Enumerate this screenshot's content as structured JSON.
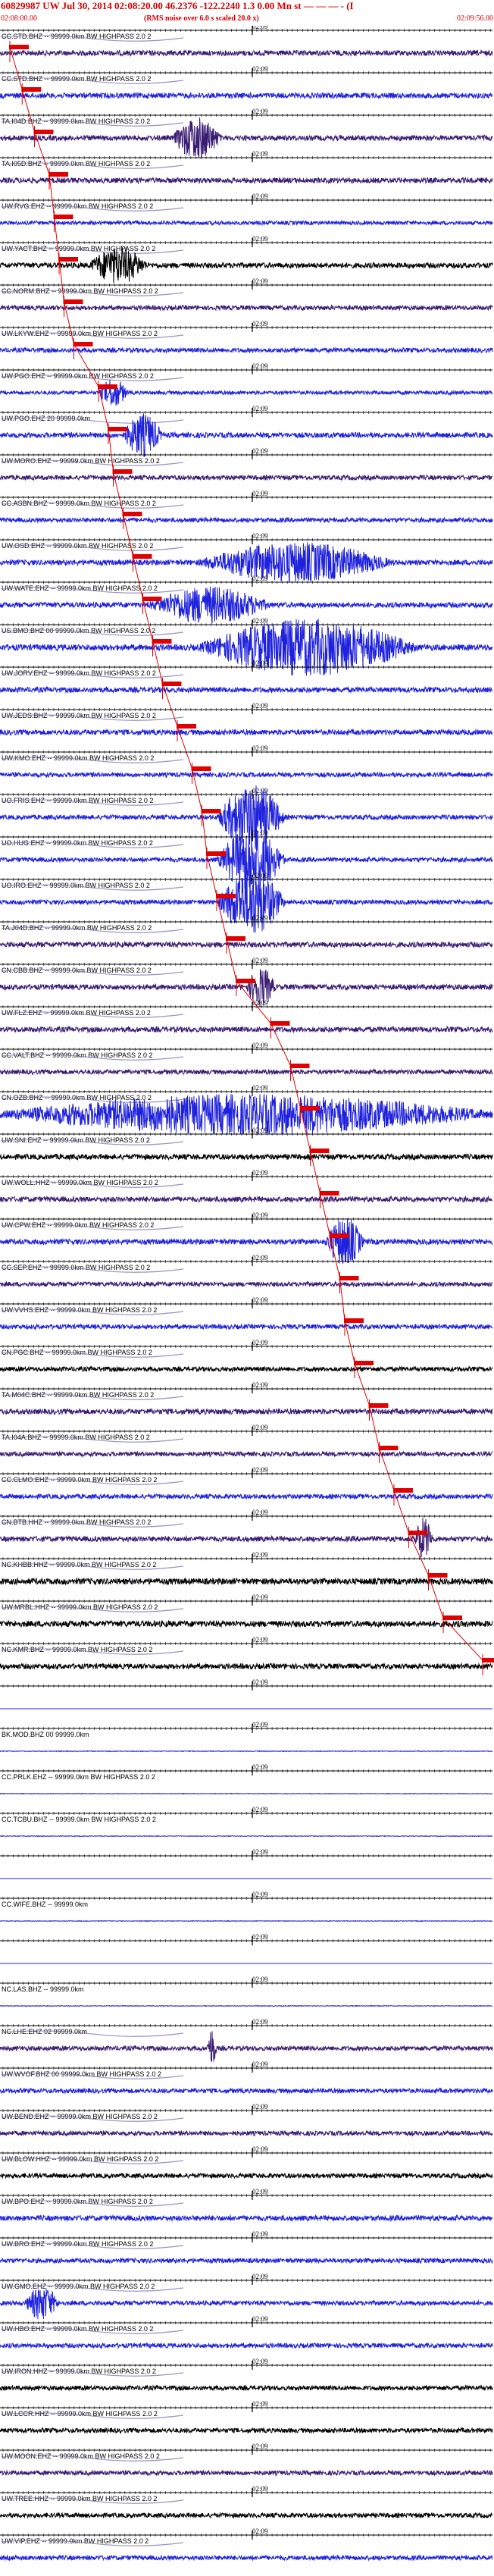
{
  "header": {
    "title": "60829987 UW Jul 30, 2014 02:08:20.00    46.2376 -122.2240  1.3 0.00 Mn st — — — - (I",
    "subtitle": "(RMS noise over 6.0 s scaled 20.0 x)",
    "time_left": "02:08:00.00",
    "time_right": "02:09:56.00"
  },
  "minute_mark": "02:09",
  "colors": {
    "header": "#d40000",
    "pick": "#e00000",
    "blue": "#1f22dd",
    "purple": "#3a1d73",
    "black": "#000000",
    "scrawl": "#7a6fb0"
  },
  "chart_data": {
    "type": "seismogram",
    "title": "60829987 UW Jul 30, 2014 02:08:20.00    46.2376 -122.2240  1.3 0.00 Mn st — — — - (I",
    "time_range": [
      "02:08:00.00",
      "02:09:56.00"
    ],
    "traces": [
      {
        "label": "CC.STD.BHZ -- 99999.0km BW HIGHPASS 2.0 2",
        "color": "purple",
        "amp": 0.35,
        "events": [],
        "pick": 0.02
      },
      {
        "label": "CC.STD.BHZ -- 99999.0km BW HIGHPASS 2.0 2",
        "color": "blue",
        "amp": 0.35,
        "events": [],
        "pick": 0.045
      },
      {
        "label": "TA.I04D.BHZ -- 99999.0km BW HIGHPASS 2.0 2",
        "color": "purple",
        "amp": 0.35,
        "events": [
          [
            0.35,
            0.45,
            1.4
          ]
        ],
        "pick": 0.07
      },
      {
        "label": "TA.I05D.BHZ -- 99999.0km BW HIGHPASS 2.0 2",
        "color": "purple",
        "amp": 0.35,
        "events": [],
        "pick": 0.1
      },
      {
        "label": "UW.RVG.EHZ -- 99999.0km BW HIGHPASS 2.0 2",
        "color": "blue",
        "amp": 0.25,
        "events": [],
        "pick": 0.11
      },
      {
        "label": "UW.YACT.BHZ -- 99999.0km BW HIGHPASS 2.0 2",
        "color": "black",
        "amp": 0.35,
        "events": [
          [
            0.18,
            0.3,
            1.2
          ]
        ],
        "pick": 0.12
      },
      {
        "label": "CC.NORM.BHZ -- 99999.0km BW HIGHPASS 2.0 2",
        "color": "purple",
        "amp": 0.3,
        "events": [],
        "pick": 0.13
      },
      {
        "label": "UW.LKYW.EHZ -- 99999.0km BW HIGHPASS 2.0 2",
        "color": "blue",
        "amp": 0.3,
        "events": [],
        "pick": 0.15
      },
      {
        "label": "UW.PGO.EHZ -- 99999.0km BW HIGHPASS 2.0 2",
        "color": "blue",
        "amp": 0.25,
        "events": [
          [
            0.2,
            0.26,
            1.3
          ]
        ],
        "pick": 0.2
      },
      {
        "label": "UW.PGO.EHZ 20 99999.0km",
        "color": "blue",
        "amp": 0.35,
        "events": [
          [
            0.25,
            0.33,
            1.4
          ]
        ],
        "pick": 0.22
      },
      {
        "label": "UW.MORO.EHZ -- 99999.0km BW HIGHPASS 2.0 2",
        "color": "purple",
        "amp": 0.3,
        "events": [],
        "pick": 0.23
      },
      {
        "label": "CC.ASBN.BHZ -- 99999.0km BW HIGHPASS 2.0 2",
        "color": "blue",
        "amp": 0.3,
        "events": [],
        "pick": 0.25
      },
      {
        "label": "UW.OSD.EHZ -- 99999.0km BW HIGHPASS 2.0 2",
        "color": "blue",
        "amp": 0.35,
        "events": [
          [
            0.4,
            0.8,
            1.3
          ]
        ],
        "pick": 0.27
      },
      {
        "label": "UW.WATE.EHZ -- 99999.0km BW HIGHPASS 2.0 2",
        "color": "blue",
        "amp": 0.35,
        "events": [
          [
            0.3,
            0.55,
            1.2
          ]
        ],
        "pick": 0.29
      },
      {
        "label": "US.BMO.BHZ 00 99999.0km BW HIGHPASS 2.0 2",
        "color": "blue",
        "amp": 0.4,
        "events": [
          [
            0.4,
            0.85,
            1.6
          ]
        ],
        "pick": 0.31
      },
      {
        "label": "UW.JORV.EHZ -- 99999.0km BW HIGHPASS 2.0 2",
        "color": "blue",
        "amp": 0.35,
        "events": [],
        "pick": 0.33
      },
      {
        "label": "UW.JEDS.BHZ -- 99999.0km BW HIGHPASS 2.0 2",
        "color": "blue",
        "amp": 0.35,
        "events": [],
        "pick": 0.36
      },
      {
        "label": "UW.KMO.EHZ -- 99999.0km BW HIGHPASS 2.0 2",
        "color": "blue",
        "amp": 0.3,
        "events": [],
        "pick": 0.39
      },
      {
        "label": "UO.FRIS.EHZ -- 99999.0km BW HIGHPASS 2.0 2",
        "color": "blue",
        "amp": 0.3,
        "events": [
          [
            0.44,
            0.58,
            2.5
          ]
        ],
        "pick": 0.41
      },
      {
        "label": "UO.HUG.EHZ -- 99999.0km BW HIGHPASS 2.0 2",
        "color": "blue",
        "amp": 0.3,
        "events": [
          [
            0.44,
            0.58,
            2.5
          ]
        ],
        "pick": 0.42
      },
      {
        "label": "UO.IRO.EHZ -- 99999.0km BW HIGHPASS 2.0 2",
        "color": "blue",
        "amp": 0.3,
        "events": [
          [
            0.44,
            0.58,
            2.5
          ]
        ],
        "pick": 0.44
      },
      {
        "label": "TA.J04D.BHZ -- 99999.0km BW HIGHPASS 2.0 2",
        "color": "purple",
        "amp": 0.35,
        "events": [],
        "pick": 0.46
      },
      {
        "label": "CN.CBB.BHZ -- 99999.0km BW HIGHPASS 2.0 2",
        "color": "purple",
        "amp": 0.35,
        "events": [
          [
            0.5,
            0.56,
            1.3
          ]
        ],
        "pick": 0.48
      },
      {
        "label": "UW.FLZ.EHZ -- 99999.0km BW HIGHPASS 2.0 2",
        "color": "purple",
        "amp": 0.35,
        "events": [],
        "pick": 0.55
      },
      {
        "label": "CC.VALT.BHZ -- 99999.0km BW HIGHPASS 2.0 2",
        "color": "purple",
        "amp": 0.3,
        "events": [],
        "pick": 0.59
      },
      {
        "label": "CN.OZB.BHZ -- 99999.0km BW HIGHPASS 2.0 2",
        "color": "blue",
        "amp": 0.45,
        "events": [
          [
            0.0,
            1.0,
            1.0
          ]
        ],
        "pick": 0.61
      },
      {
        "label": "UW.SNI.EHZ -- 99999.0km BW HIGHPASS 2.0 2",
        "color": "black",
        "amp": 0.35,
        "events": [],
        "pick": 0.63
      },
      {
        "label": "UW.WOLL.HHZ -- 99999.0km BW HIGHPASS 2.0 2",
        "color": "purple",
        "amp": 0.35,
        "events": [],
        "pick": 0.65
      },
      {
        "label": "UW.CPW.EHZ -- 99999.0km BW HIGHPASS 2.0 2",
        "color": "blue",
        "amp": 0.35,
        "events": [
          [
            0.66,
            0.74,
            1.6
          ]
        ],
        "pick": 0.67
      },
      {
        "label": "CC.SEP.EHZ -- 99999.0km BW HIGHPASS 2.0 2",
        "color": "purple",
        "amp": 0.3,
        "events": [],
        "pick": 0.69
      },
      {
        "label": "UW.VVHS.EHZ -- 99999.0km BW HIGHPASS 2.0 2",
        "color": "blue",
        "amp": 0.3,
        "events": [],
        "pick": 0.7
      },
      {
        "label": "CN.PGC.BHZ -- 99999.0km BW HIGHPASS 2.0 2",
        "color": "black",
        "amp": 0.3,
        "events": [],
        "pick": 0.72
      },
      {
        "label": "TA.M04C.BHZ -- 99999.0km BW HIGHPASS 2.0 2",
        "color": "purple",
        "amp": 0.35,
        "events": [],
        "pick": 0.75
      },
      {
        "label": "TA.I04A.BHZ -- 99999.0km BW HIGHPASS 2.0 2",
        "color": "purple",
        "amp": 0.3,
        "events": [],
        "pick": 0.77
      },
      {
        "label": "CC.CLMO.EHZ -- 99999.0km BW HIGHPASS 2.0 2",
        "color": "blue",
        "amp": 0.3,
        "events": [],
        "pick": 0.8
      },
      {
        "label": "CN.BTB.HHZ -- 99999.0km BW HIGHPASS 2.0 2",
        "color": "purple",
        "amp": 0.35,
        "events": [
          [
            0.84,
            0.88,
            1.4
          ]
        ],
        "pick": 0.83
      },
      {
        "label": "NC.KHBB.HHZ -- 99999.0km BW HIGHPASS 2.0 2",
        "color": "black",
        "amp": 0.4,
        "events": [],
        "pick": 0.87
      },
      {
        "label": "UW.MRBL.HHZ -- 99999.0km BW HIGHPASS 2.0 2",
        "color": "black",
        "amp": 0.4,
        "events": [],
        "pick": 0.9
      },
      {
        "label": "NC.KMR.BHZ -- 99999.0km BW HIGHPASS 2.0 2",
        "color": "black",
        "amp": 0.35,
        "events": [],
        "pick": 0.98
      },
      {
        "label": "",
        "color": "blue",
        "amp": 0.0,
        "events": [],
        "pick": null
      },
      {
        "label": "BK.MOD.BHZ 00 99999.0km",
        "color": "blue",
        "amp": 0.04,
        "events": [],
        "pick": null
      },
      {
        "label": "CC.PRLK.EHZ -- 99999.0km BW HIGHPASS 2.0 2",
        "color": "blue",
        "amp": 0.04,
        "events": [],
        "pick": null
      },
      {
        "label": "CC.TCBU.BHZ -- 99999.0km BW HIGHPASS 2.0 2",
        "color": "blue",
        "amp": 0.04,
        "events": [],
        "pick": null
      },
      {
        "label": "",
        "color": "blue",
        "amp": 0.0,
        "events": [],
        "pick": null
      },
      {
        "label": "CC.WIFE.BHZ -- 99999.0km",
        "color": "blue",
        "amp": 0.04,
        "events": [],
        "pick": null
      },
      {
        "label": "",
        "color": "blue",
        "amp": 0.0,
        "events": [],
        "pick": null
      },
      {
        "label": "NC.LAS.BHZ -- 99999.0km",
        "color": "blue",
        "amp": 0.04,
        "events": [],
        "pick": null
      },
      {
        "label": "NC.LHE.EHZ 02 99999.0km",
        "color": "purple",
        "amp": 0.3,
        "events": [
          [
            0.42,
            0.44,
            1.5
          ]
        ],
        "pick": null
      },
      {
        "label": "UW.WVOF.BHZ 00 99999.0km BW HIGHPASS 2.0 2",
        "color": "blue",
        "amp": 0.3,
        "events": [],
        "pick": null
      },
      {
        "label": "UW.BEND.EHZ -- 99999.0km BW HIGHPASS 2.0 2",
        "color": "purple",
        "amp": 0.3,
        "events": [],
        "pick": null
      },
      {
        "label": "UW.BLOW.HHZ -- 99999.0km BW HIGHPASS 2.0 2",
        "color": "black",
        "amp": 0.3,
        "events": [],
        "pick": null
      },
      {
        "label": "UW.BPO.EHZ -- 99999.0km BW HIGHPASS 2.0 2",
        "color": "blue",
        "amp": 0.35,
        "events": [],
        "pick": null
      },
      {
        "label": "UW.BRO.EHZ -- 99999.0km BW HIGHPASS 2.0 2",
        "color": "blue",
        "amp": 0.3,
        "events": [],
        "pick": null
      },
      {
        "label": "UW.GMO.EHZ -- 99999.0km BW HIGHPASS 2.0 2",
        "color": "blue",
        "amp": 0.3,
        "events": [
          [
            0.05,
            0.12,
            1.3
          ]
        ],
        "pick": null
      },
      {
        "label": "UW.HBO.EHZ -- 99999.0km BW HIGHPASS 2.0 2",
        "color": "blue",
        "amp": 0.3,
        "events": [],
        "pick": null
      },
      {
        "label": "UW.IRON.HHZ -- 99999.0km BW HIGHPASS 2.0 2",
        "color": "black",
        "amp": 0.3,
        "events": [],
        "pick": null
      },
      {
        "label": "UW.LCCR.HHZ -- 99999.0km BW HIGHPASS 2.0 2",
        "color": "black",
        "amp": 0.3,
        "events": [],
        "pick": null
      },
      {
        "label": "UW.MOON.EHZ -- 99999.0km BW HIGHPASS 2.0 2",
        "color": "purple",
        "amp": 0.3,
        "events": [],
        "pick": null
      },
      {
        "label": "UW.TREE.HHZ -- 99999.0km BW HIGHPASS 2.0 2",
        "color": "black",
        "amp": 0.3,
        "events": [],
        "pick": null
      },
      {
        "label": "UW.VIP.EHZ -- 99999.0km BW HIGHPASS 2.0 2",
        "color": "blue",
        "amp": 0.3,
        "events": [],
        "pick": null
      }
    ]
  }
}
